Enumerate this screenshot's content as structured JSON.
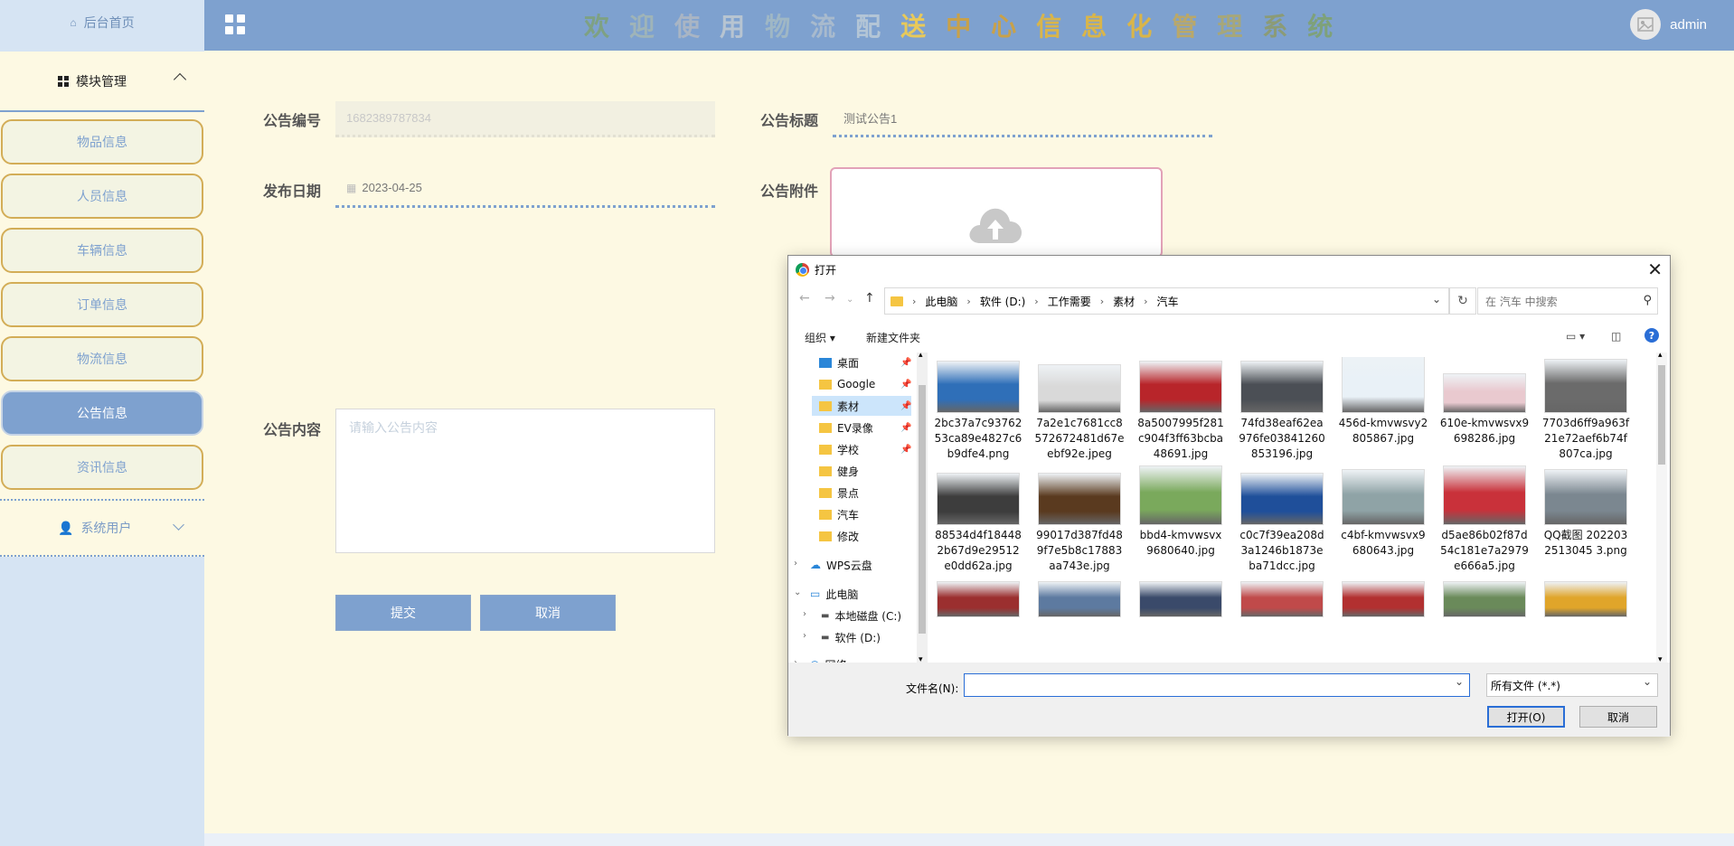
{
  "sidebar": {
    "home": "后台首页",
    "module": "模块管理",
    "items": [
      {
        "label": "物品信息"
      },
      {
        "label": "人员信息"
      },
      {
        "label": "车辆信息"
      },
      {
        "label": "订单信息"
      },
      {
        "label": "物流信息"
      },
      {
        "label": "公告信息"
      },
      {
        "label": "资讯信息"
      }
    ],
    "users": "系统用户"
  },
  "header": {
    "title_chars": [
      "欢",
      "迎",
      "使",
      "用",
      "物",
      "流",
      "配",
      "送",
      "中",
      "心",
      "信",
      "息",
      "化",
      "管",
      "理",
      "系",
      "统"
    ],
    "title_colors": [
      "#7ea183",
      "#9fb4b8",
      "#a9b5c4",
      "#b7c4d1",
      "#9fb7c5",
      "#a8bacd",
      "#b3c5d6",
      "#e8c95a",
      "#c8a14a",
      "#c8a14a",
      "#d9b54a",
      "#d9b54a",
      "#d9b54a",
      "#b9a86a",
      "#a6a77a",
      "#8b9b77",
      "#7ea17a"
    ],
    "user": "admin"
  },
  "form": {
    "id_label": "公告编号",
    "id_value": "1682389787834",
    "title_label": "公告标题",
    "title_value": "测试公告1",
    "date_label": "发布日期",
    "date_value": "2023-04-25",
    "attach_label": "公告附件",
    "content_label": "公告内容",
    "content_placeholder": "请输入公告内容",
    "submit": "提交",
    "cancel": "取消"
  },
  "dialog": {
    "title": "打开",
    "breadcrumbs": [
      "此电脑",
      "软件 (D:)",
      "工作需要",
      "素材",
      "汽车"
    ],
    "search_placeholder": "在 汽车 中搜索",
    "organize": "组织 ▾",
    "new_folder": "新建文件夹",
    "tree": [
      {
        "label": "桌面",
        "pinned": true
      },
      {
        "label": "Google",
        "pinned": true
      },
      {
        "label": "素材",
        "pinned": true
      },
      {
        "label": "EV录像",
        "pinned": true
      },
      {
        "label": "学校",
        "pinned": true
      },
      {
        "label": "健身",
        "pinned": false
      },
      {
        "label": "景点",
        "pinned": false
      },
      {
        "label": "汽车",
        "pinned": false
      },
      {
        "label": "修改",
        "pinned": false
      },
      {
        "label": "WPS云盘",
        "pinned": false
      },
      {
        "label": "此电脑",
        "pinned": false
      },
      {
        "label": "本地磁盘 (C:)",
        "pinned": false
      },
      {
        "label": "软件 (D:)",
        "pinned": false
      },
      {
        "label": "网络",
        "pinned": false
      }
    ],
    "files": [
      {
        "name": "2bc37a7c93762 53ca89e4827c6 b9dfe4.png",
        "color": "#2f6fb8"
      },
      {
        "name": "7a2e1c7681cc8 572672481d67e ebf92e.jpeg",
        "color": "#d9d9d9"
      },
      {
        "name": "8a5007995f281 c904f3ff63bcba 48691.jpg",
        "color": "#b8252a"
      },
      {
        "name": "74fd38eaf62ea 976fe03841260 853196.jpg",
        "color": "#4b4f55"
      },
      {
        "name": "456d-kmvwsvy2 805867.jpg",
        "color": "#e9f1f7"
      },
      {
        "name": "610e-kmvwsvx9 698286.jpg",
        "color": "#e9c9cf"
      },
      {
        "name": "7703d6ff9a963f 21e72aef6b74f 807ca.jpg",
        "color": "#6b6b6b"
      },
      {
        "name": "88534d4f18448 2b67d9e29512 e0dd62a.jpg",
        "color": "#3d3d3d"
      },
      {
        "name": "99017d387fd48 9f7e5b8c17883 aa743e.jpg",
        "color": "#5a3a1f"
      },
      {
        "name": "bbd4-kmvwsvx 9680640.jpg",
        "color": "#7aa95c"
      },
      {
        "name": "c0c7f39ea208d 3a1246b1873e ba71dcc.jpg",
        "color": "#1f4f9a"
      },
      {
        "name": "c4bf-kmvwsvx9 680643.jpg",
        "color": "#8fa3a6"
      },
      {
        "name": "d5ae86b02f87d 54c181e7a2979 e666a5.jpg",
        "color": "#c9313a"
      },
      {
        "name": "QQ截图 2022032513045 3.png",
        "color": "#7b8790"
      },
      {
        "name": "",
        "color": "#9b2f2f"
      },
      {
        "name": "",
        "color": "#5d7aa0"
      },
      {
        "name": "",
        "color": "#3a4a6a"
      },
      {
        "name": "",
        "color": "#c04a4a"
      },
      {
        "name": "",
        "color": "#b23030"
      },
      {
        "name": "",
        "color": "#6a8a5a"
      },
      {
        "name": "",
        "color": "#e0a52a"
      }
    ],
    "filename_label": "文件名(N):",
    "filter": "所有文件 (*.*)",
    "open": "打开(O)",
    "cancel": "取消"
  }
}
